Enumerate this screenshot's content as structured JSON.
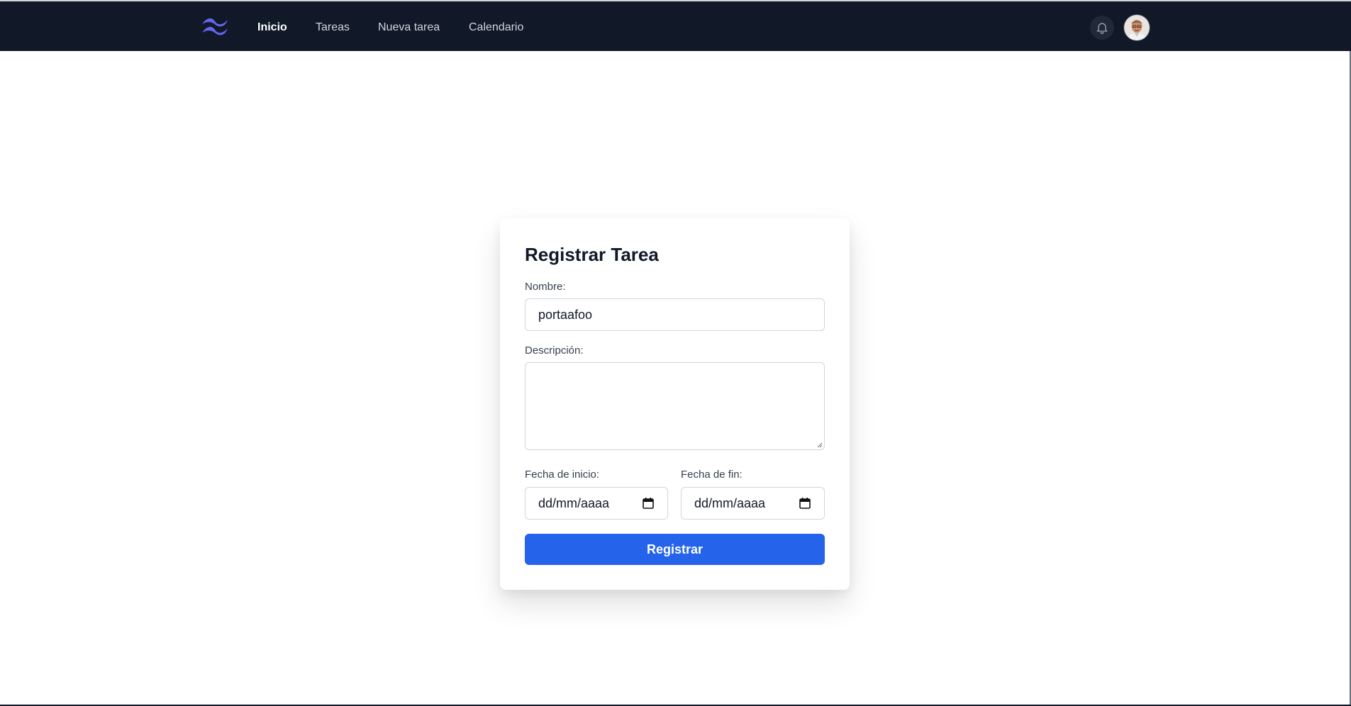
{
  "nav": {
    "brand_icon": "tailwind-logo-icon",
    "links": [
      {
        "label": "Inicio",
        "active": true
      },
      {
        "label": "Tareas",
        "active": false
      },
      {
        "label": "Nueva tarea",
        "active": false
      },
      {
        "label": "Calendario",
        "active": false
      }
    ],
    "notification_icon": "bell-icon",
    "avatar_icon": "user-avatar"
  },
  "form": {
    "title": "Registrar Tarea",
    "nombre": {
      "label": "Nombre:",
      "value": "portaafoo"
    },
    "descripcion": {
      "label": "Descripción:",
      "value": ""
    },
    "fecha_inicio": {
      "label": "Fecha de inicio:",
      "placeholder": "dd/mm/aaaa"
    },
    "fecha_fin": {
      "label": "Fecha de fin:",
      "placeholder": "dd/mm/aaaa"
    },
    "submit_label": "Registrar"
  },
  "colors": {
    "navbar_bg": "#111827",
    "brand_accent": "#6366f1",
    "primary_button": "#2563eb",
    "text_primary": "#111827",
    "label_text": "#374151",
    "input_border": "#d1d5db"
  }
}
